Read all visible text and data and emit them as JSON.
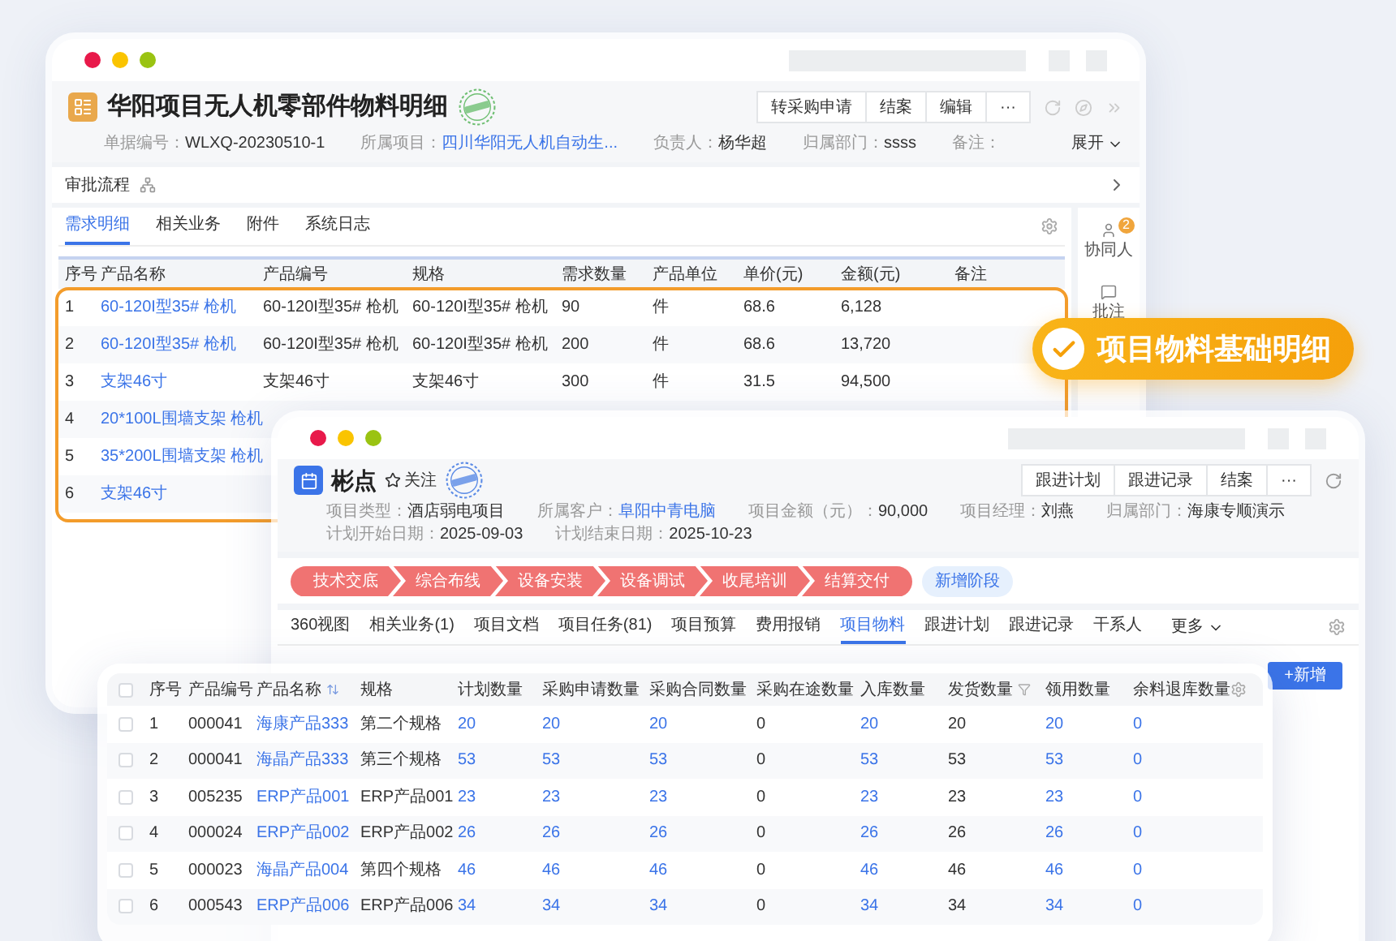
{
  "back_window": {
    "title": "华阳项目无人机零部件物料明细",
    "actions": [
      "转采购申请",
      "结案",
      "编辑",
      "···"
    ],
    "meta": [
      {
        "label": "单据编号：",
        "value": "WLXQ-20230510-1",
        "link": false
      },
      {
        "label": "所属项目：",
        "value": "四川华阳无人机自动生...",
        "link": true
      },
      {
        "label": "负责人：",
        "value": "杨华超",
        "link": false
      },
      {
        "label": "归属部门：",
        "value": "ssss",
        "link": false
      },
      {
        "label": "备注：",
        "link": false
      }
    ],
    "expand": "展开",
    "approval": "审批流程",
    "tabs": [
      {
        "label": "需求明细",
        "selected": true
      },
      {
        "label": "相关业务",
        "selected": false
      },
      {
        "label": "附件",
        "selected": false
      },
      {
        "label": "系统日志",
        "selected": false
      }
    ],
    "side": [
      {
        "kind": "people",
        "label": "协同人",
        "badge": "2"
      },
      {
        "kind": "comment",
        "label": "批注"
      }
    ],
    "table": {
      "columns": [
        {
          "label": "序号",
          "kind": "text"
        },
        {
          "label": "产品名称",
          "kind": "link"
        },
        {
          "label": "产品编号",
          "kind": "text"
        },
        {
          "label": "规格",
          "kind": "text"
        },
        {
          "label": "需求数量",
          "kind": "text"
        },
        {
          "label": "产品单位",
          "kind": "text"
        },
        {
          "label": "单价(元)",
          "kind": "text"
        },
        {
          "label": "金额(元)",
          "kind": "text"
        },
        {
          "label": "备注"
        }
      ],
      "rows": [
        {
          "cells": [
            "1",
            "60-120I型35# 枪机",
            "60-120I型35# 枪机",
            "60-120I型35# 枪机",
            "90",
            "件",
            "68.6",
            "6,128"
          ]
        },
        {
          "cells": [
            "2",
            "60-120I型35# 枪机",
            "60-120I型35# 枪机",
            "60-120I型35# 枪机",
            "200",
            "件",
            "68.6",
            "13,720"
          ]
        },
        {
          "cells": [
            "3",
            "支架46寸",
            "支架46寸",
            "支架46寸",
            "300",
            "件",
            "31.5",
            "94,500"
          ]
        },
        {
          "cells": [
            "4",
            "20*100L围墙支架 枪机"
          ]
        },
        {
          "cells": [
            "5",
            "35*200L围墙支架 枪机"
          ]
        },
        {
          "cells": [
            "6",
            "支架46寸"
          ]
        }
      ]
    }
  },
  "front_window": {
    "title": "彬点",
    "follow": "关注",
    "actions": [
      "跟进计划",
      "跟进记录",
      "结案",
      "···"
    ],
    "meta": [
      {
        "label": "项目类型：",
        "value": "酒店弱电项目",
        "link": false
      },
      {
        "label": "所属客户：",
        "value": "阜阳中青电脑",
        "link": true
      },
      {
        "label": "项目金额（元）：",
        "value": "90,000",
        "link": false
      },
      {
        "label": "项目经理：",
        "value": "刘燕",
        "link": false
      },
      {
        "label": "归属部门：",
        "value": "海康专顺演示",
        "link": false
      },
      {
        "label": "计划开始日期：",
        "value": "2025-09-03",
        "link": false
      },
      {
        "label": "计划结束日期：",
        "value": "2025-10-23",
        "link": false
      }
    ],
    "stages": [
      "技术交底",
      "综合布线",
      "设备安装",
      "设备调试",
      "收尾培训",
      "结算交付"
    ],
    "add_stage": "新增阶段",
    "tabs": [
      {
        "label": "360视图",
        "selected": false
      },
      {
        "label": "相关业务(1)",
        "selected": false
      },
      {
        "label": "项目文档",
        "selected": false
      },
      {
        "label": "项目任务(81)",
        "selected": false
      },
      {
        "label": "项目预算",
        "selected": false
      },
      {
        "label": "费用报销",
        "selected": false
      },
      {
        "label": "项目物料",
        "selected": true
      },
      {
        "label": "跟进计划",
        "selected": false
      },
      {
        "label": "跟进记录",
        "selected": false
      },
      {
        "label": "干系人",
        "selected": false
      }
    ],
    "more": "更多",
    "add_button": "+新增"
  },
  "floating_table": {
    "all_checked": false,
    "columns": [
      {
        "label": "序号",
        "link": false,
        "kind": "plain"
      },
      {
        "label": "产品编号",
        "link": false,
        "kind": "plain"
      },
      {
        "label": "产品名称",
        "link": true,
        "kind": "sortable"
      },
      {
        "label": "规格",
        "link": false,
        "kind": "plain"
      },
      {
        "label": "计划数量",
        "link": true,
        "kind": "plain"
      },
      {
        "label": "采购申请数量",
        "link": true,
        "kind": "plain"
      },
      {
        "label": "采购合同数量",
        "link": true,
        "kind": "plain"
      },
      {
        "label": "采购在途数量",
        "link": false,
        "kind": "plain"
      },
      {
        "label": "入库数量",
        "link": true,
        "kind": "plain"
      },
      {
        "label": "发货数量",
        "link": false,
        "kind": "filterable"
      },
      {
        "label": "领用数量",
        "link": true,
        "kind": "plain"
      },
      {
        "label": "余料退库数量",
        "link": true,
        "kind": "plain"
      }
    ],
    "rows": [
      {
        "checked": false,
        "cells": [
          "1",
          "000041",
          "海康产品333",
          "第二个规格",
          "20",
          "20",
          "20",
          "0",
          "20",
          "20",
          "20",
          "0"
        ]
      },
      {
        "checked": false,
        "cells": [
          "2",
          "000041",
          "海晶产品333",
          "第三个规格",
          "53",
          "53",
          "53",
          "0",
          "53",
          "53",
          "53",
          "0"
        ]
      },
      {
        "checked": false,
        "cells": [
          "3",
          "005235",
          "ERP产品001",
          "ERP产品001",
          "23",
          "23",
          "23",
          "0",
          "23",
          "23",
          "23",
          "0"
        ]
      },
      {
        "checked": false,
        "cells": [
          "4",
          "000024",
          "ERP产品002",
          "ERP产品002",
          "26",
          "26",
          "26",
          "0",
          "26",
          "26",
          "26",
          "0"
        ]
      },
      {
        "checked": false,
        "cells": [
          "5",
          "000023",
          "海晶产品004",
          "第四个规格",
          "46",
          "46",
          "46",
          "0",
          "46",
          "46",
          "46",
          "0"
        ]
      },
      {
        "checked": false,
        "cells": [
          "6",
          "000543",
          "ERP产品006",
          "ERP产品006",
          "34",
          "34",
          "34",
          "0",
          "34",
          "34",
          "34",
          "0"
        ]
      }
    ]
  },
  "badge": {
    "text": "项目物料基础明细"
  }
}
